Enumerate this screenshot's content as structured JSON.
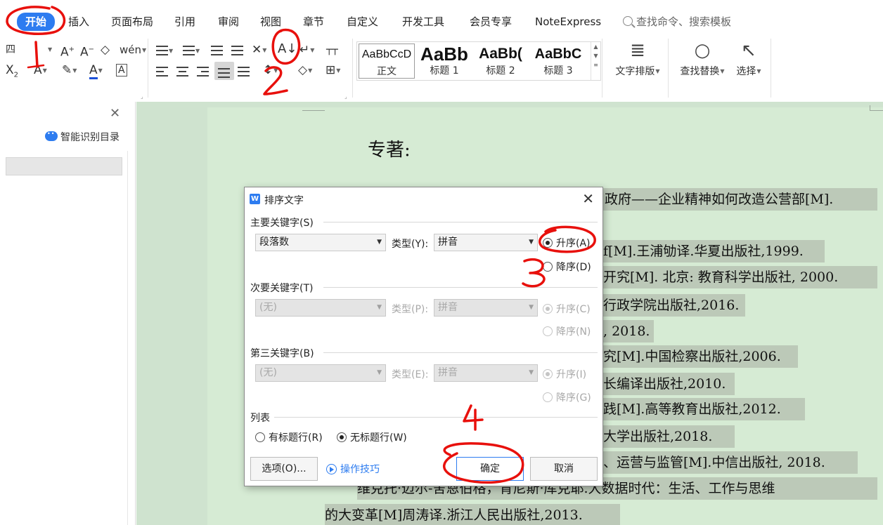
{
  "menu": {
    "items": [
      "开始",
      "插入",
      "页面布局",
      "引用",
      "审阅",
      "视图",
      "章节",
      "自定义",
      "开发工具",
      "会员专享",
      "NoteExpress"
    ],
    "active_index": 0,
    "search_placeholder": "查找命令、搜索模板"
  },
  "ribbon": {
    "font_size_value": "四",
    "style_samples": [
      {
        "sample": "AaBbCcD",
        "name": "正文"
      },
      {
        "sample": "AaBb",
        "name": "标题 1"
      },
      {
        "sample": "AaBb(",
        "name": "标题 2"
      },
      {
        "sample": "AaBbC",
        "name": "标题 3"
      }
    ],
    "text_layout_label": "文字排版",
    "find_replace_label": "查找替换",
    "select_label": "选择"
  },
  "left_pane": {
    "smart_toc_label": "智能识别目录"
  },
  "document": {
    "heading": "专著:",
    "lines": [
      "政府——企业精神如何改造公营部[M].",
      "f[M].王浦劬译.华夏出版社,1999.",
      "开究[M]. 北京: 教育科学出版社, 2000.",
      "行政学院出版社,2016.",
      ", 2018.",
      "究[M].中国检察出版社,2006.",
      "长编译出版社,2010.",
      "践[M].高等教育出版社,2012.",
      "大学出版社,2018.",
      "、运营与监管[M].中信出版社, 2018.",
      "维克托·迈尔-舍恩伯格，肯尼斯·库克耶.大数据时代：生活、工作与思维",
      "的大变革[M]周涛译.浙江人民出版社,2013."
    ]
  },
  "dialog": {
    "title": "排序文字",
    "primary_key_label": "主要关键字(S)",
    "primary_key_value": "段落数",
    "primary_type_label": "类型(Y):",
    "primary_type_value": "拼音",
    "asc_label": "升序(A)",
    "desc_label": "降序(D)",
    "secondary_key_label": "次要关键字(T)",
    "secondary_key_value": "(无)",
    "secondary_type_label": "类型(P):",
    "secondary_type_value": "拼音",
    "secondary_asc_label": "升序(C)",
    "secondary_desc_label": "降序(N)",
    "third_key_label": "第三关键字(B)",
    "third_key_value": "(无)",
    "third_type_label": "类型(E):",
    "third_type_value": "拼音",
    "third_asc_label": "升序(I)",
    "third_desc_label": "降序(G)",
    "list_label": "列表",
    "has_header_label": "有标题行(R)",
    "no_header_label": "无标题行(W)",
    "options_button": "选项(O)...",
    "tips_link": "操作技巧",
    "ok_button": "确定",
    "cancel_button": "取消"
  },
  "annotations": [
    "1",
    "2",
    "3",
    "4"
  ],
  "colors": {
    "accent": "#2d7cf0",
    "annotation_red": "#e8100c",
    "page_green": "#d6ebd4",
    "highlight": "#bcc9b8"
  }
}
